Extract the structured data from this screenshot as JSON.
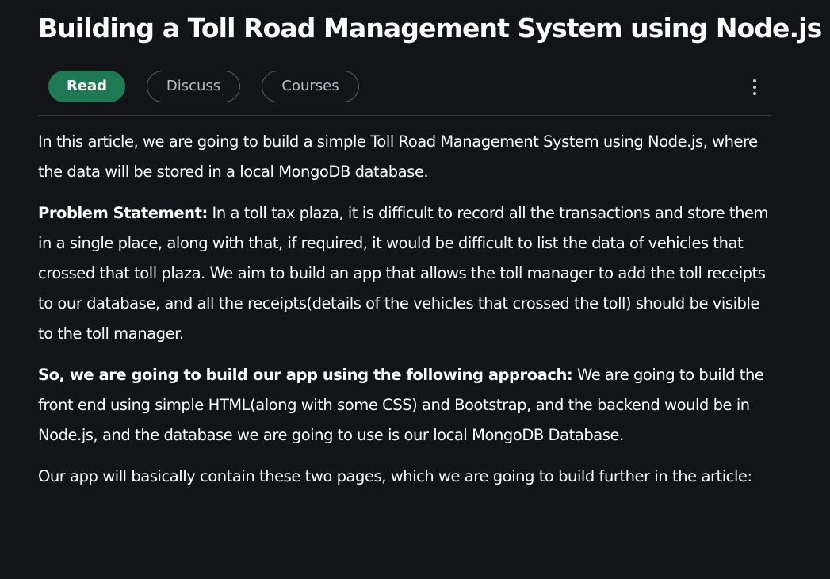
{
  "article": {
    "title": "Building a Toll Road Management System using Node.js"
  },
  "tabs": {
    "read": "Read",
    "discuss": "Discuss",
    "courses": "Courses"
  },
  "content": {
    "intro": "In this article, we are going to build a simple Toll Road Management System using Node.js, where the data will be stored in a local MongoDB database.",
    "problem_label": "Problem Statement:",
    "problem_text": " In a toll tax plaza, it is difficult to record all the transactions and store them in a single place, along with that, if required, it would be difficult to list the data of vehicles that crossed that toll plaza. We aim to build an app that allows the toll manager to add the toll receipts to our database, and all the receipts(details of the vehicles that crossed the toll) should be visible to the toll manager.",
    "approach_label": "So, we are going to build our app using the following approach:",
    "approach_text": " We are going to build the front end using simple HTML(along with some CSS) and Bootstrap, and the backend would be in Node.js, and the database we are going to use is our local MongoDB Database.",
    "pages_text": "Our app will basically contain these two pages, which we are going to build further in the article:"
  },
  "icons": {
    "more": "more-vertical-icon"
  },
  "colors": {
    "background": "#131417",
    "accent": "#1d7a52",
    "text": "#ffffff",
    "muted": "#b8bbc0"
  }
}
